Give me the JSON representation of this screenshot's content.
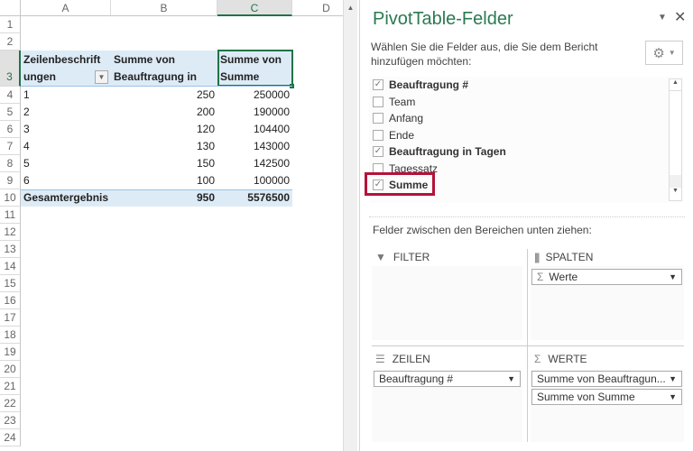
{
  "sheet": {
    "columns": [
      "A",
      "B",
      "C",
      "D"
    ],
    "rows": [
      "1",
      "2",
      "3",
      "4",
      "5",
      "6",
      "7",
      "8",
      "9",
      "10",
      "11",
      "12",
      "13",
      "14",
      "15",
      "16",
      "17",
      "18",
      "19",
      "20",
      "21",
      "22",
      "23",
      "24"
    ],
    "pivot": {
      "header_a1": "Zeilenbeschrift",
      "header_a2": "ungen",
      "header_b1": "Summe von",
      "header_b2": "Beauftragung in",
      "header_c1": "Summe von",
      "header_c2": "Summe",
      "data": [
        [
          "1",
          "250",
          "250000"
        ],
        [
          "2",
          "200",
          "190000"
        ],
        [
          "3",
          "120",
          "104400"
        ],
        [
          "4",
          "130",
          "143000"
        ],
        [
          "5",
          "150",
          "142500"
        ],
        [
          "6",
          "100",
          "100000"
        ]
      ],
      "total": [
        "Gesamtergebnis",
        "950",
        "5576500"
      ]
    }
  },
  "panel": {
    "title": "PivotTable-Felder",
    "description": "Wählen Sie die Felder aus, die Sie dem Bericht hinzufügen möchten:",
    "fields": [
      {
        "label": "Beauftragung #",
        "checked": true
      },
      {
        "label": "Team",
        "checked": false
      },
      {
        "label": "Anfang",
        "checked": false
      },
      {
        "label": "Ende",
        "checked": false
      },
      {
        "label": "Beauftragung in Tagen",
        "checked": true
      },
      {
        "label": "Tagessatz",
        "checked": false
      },
      {
        "label": "Summe",
        "checked": true
      }
    ],
    "highlight_color": "#b4123a",
    "drag_hint": "Felder zwischen den Bereichen unten ziehen:",
    "areas": {
      "filter": "FILTER",
      "columns": "SPALTEN",
      "rows": "ZEILEN",
      "values": "WERTE",
      "columns_items": [
        "Werte"
      ],
      "rows_items": [
        "Beauftragung #"
      ],
      "values_items": [
        "Summe von Beauftragun...",
        "Summe von Summe"
      ]
    }
  }
}
